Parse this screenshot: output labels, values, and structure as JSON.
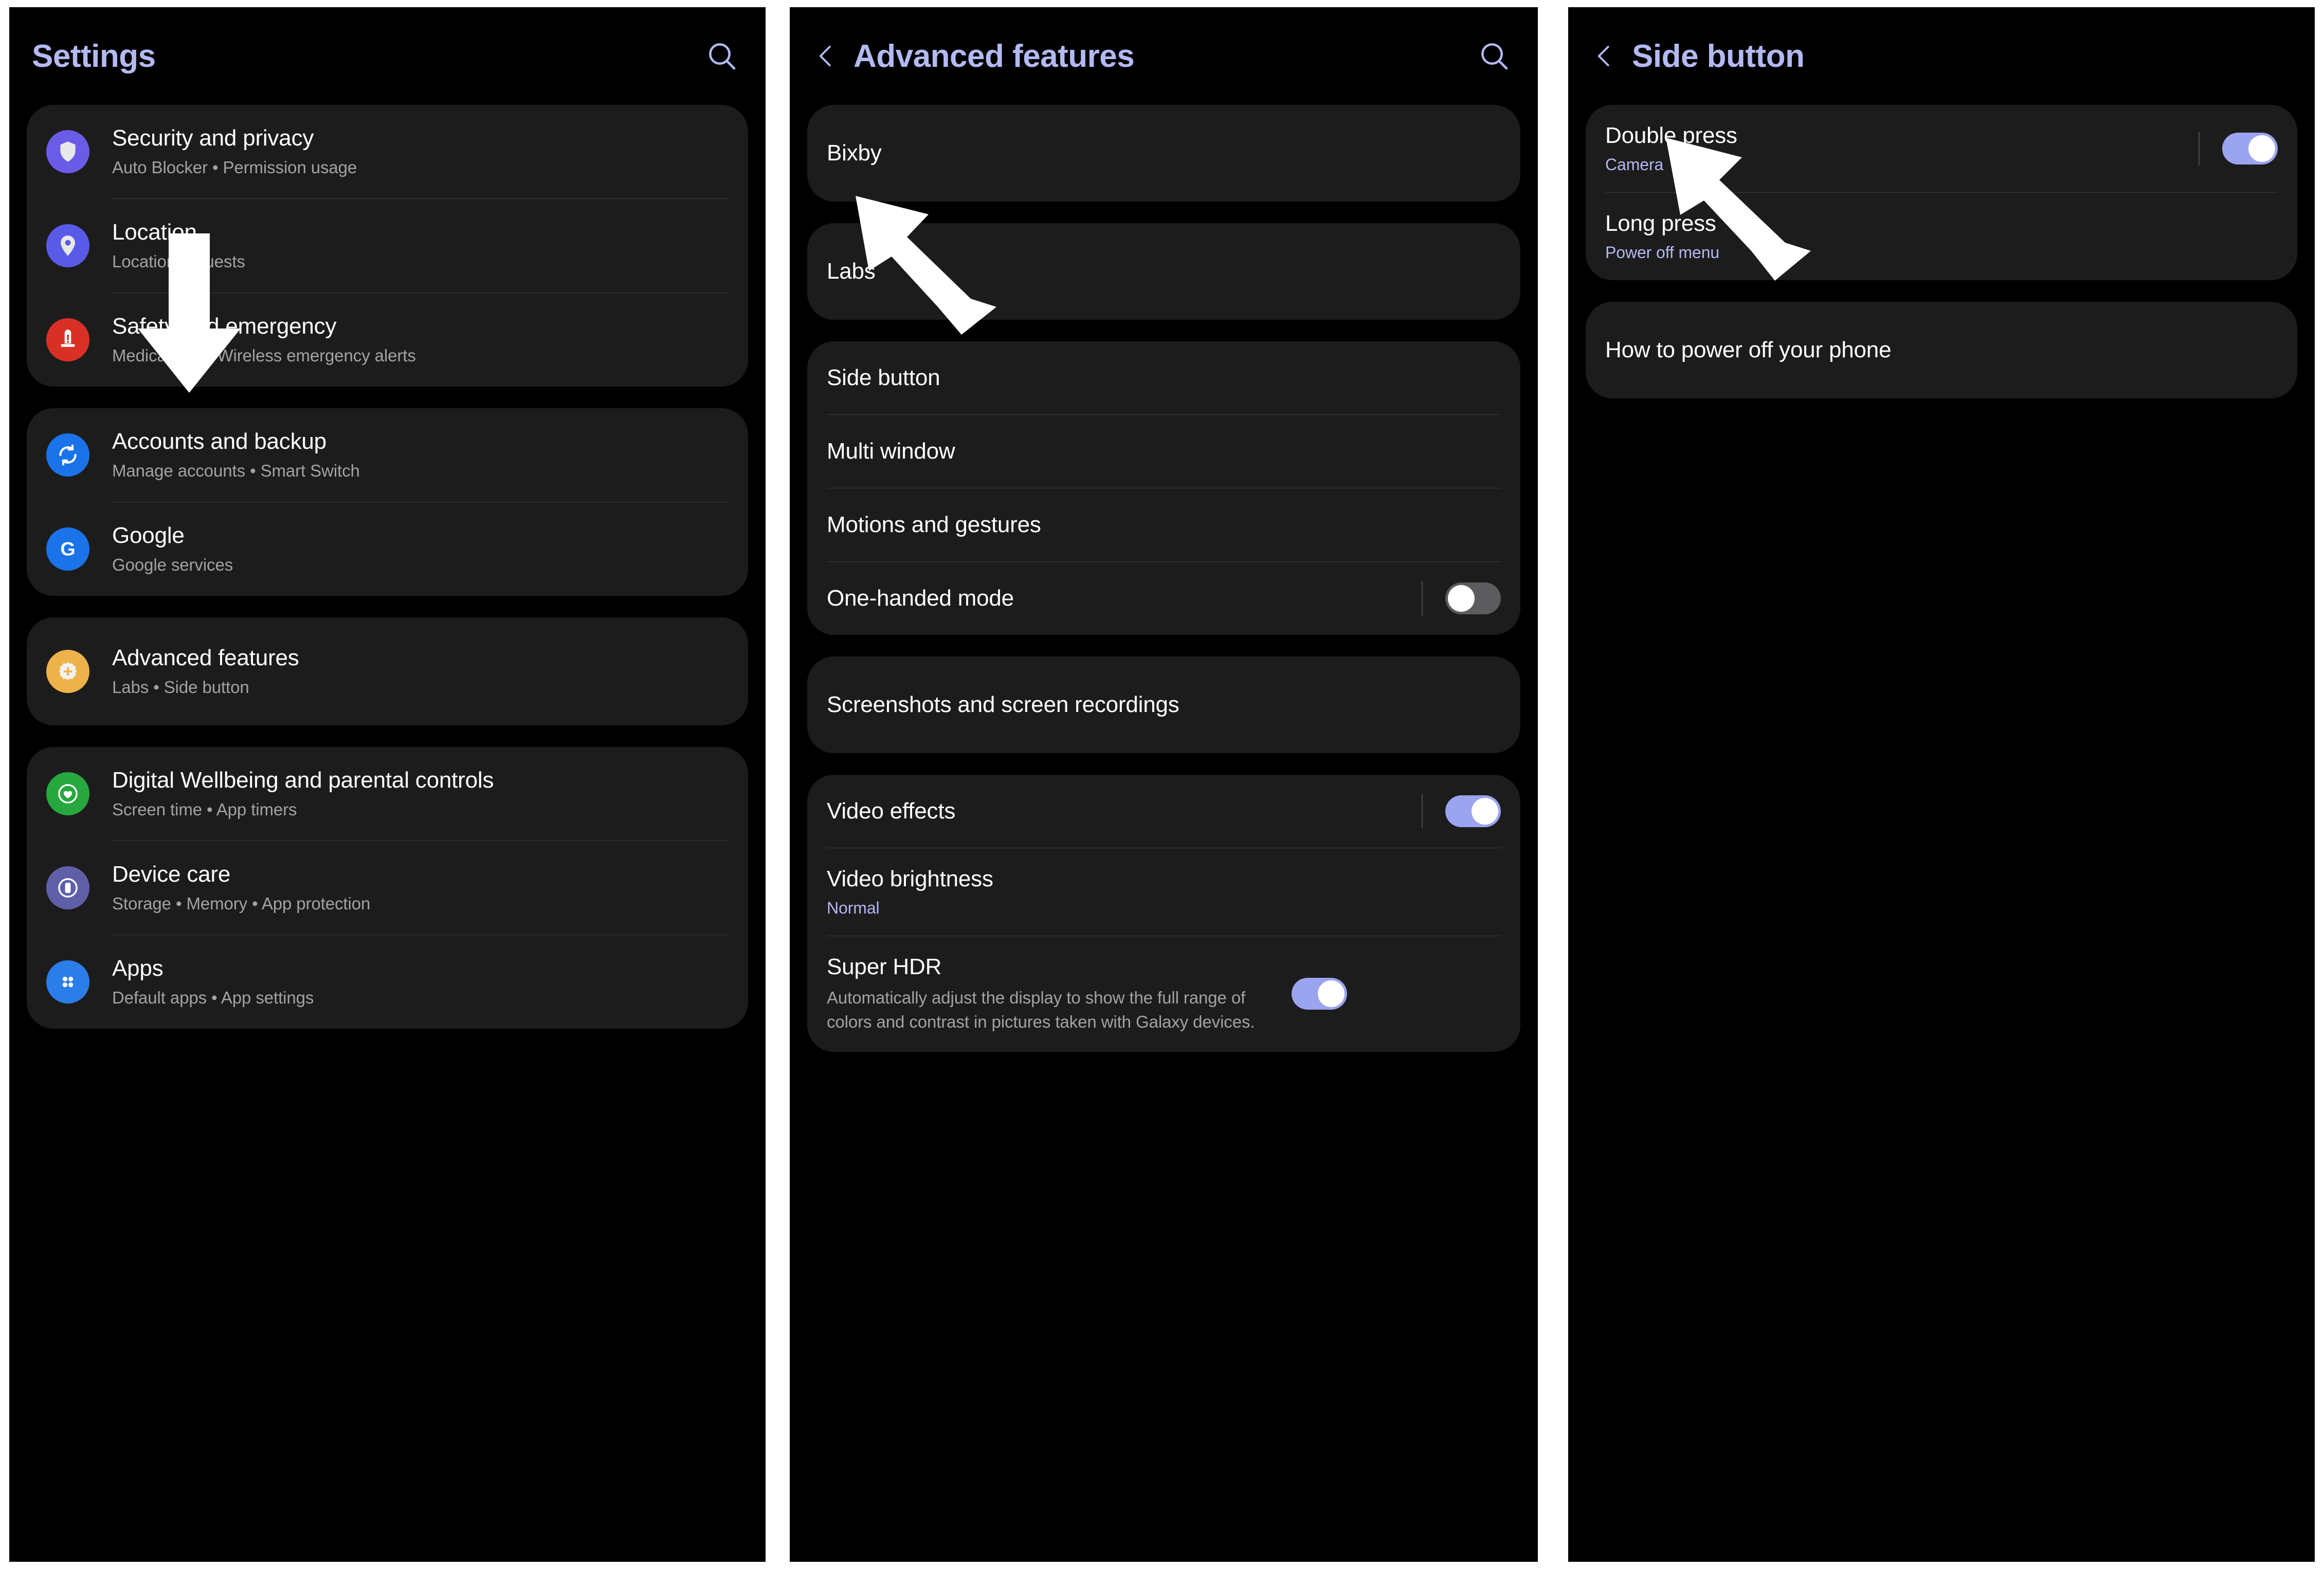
{
  "colors": {
    "panel_bg": "#000000",
    "card_bg": "#1c1c1c",
    "accent": "#b3b9f2",
    "toggle_on": "#9aa4ef",
    "toggle_off": "#5c5c5e",
    "title_text": "#ffffff",
    "sub_text": "#a3a3a3",
    "divider": "#3a3a3a"
  },
  "panels": [
    {
      "id": "settings",
      "header": {
        "title": "Settings",
        "has_back": false,
        "search_icon": "search-icon"
      },
      "groups": [
        {
          "items": [
            {
              "title": "Security and privacy",
              "sub": "Auto Blocker  •  Permission usage",
              "icon": "shield-icon",
              "icon_color": "#6b5ce7"
            },
            {
              "title": "Location",
              "sub": "Location requests",
              "icon": "location-pin-icon",
              "icon_color": "#5a5ae8"
            },
            {
              "title": "Safety and emergency",
              "sub": "Medical info  •  Wireless emergency alerts",
              "icon": "emergency-alert-icon",
              "icon_color": "#d93025"
            }
          ]
        },
        {
          "items": [
            {
              "title": "Accounts and backup",
              "sub": "Manage accounts  •  Smart Switch",
              "icon": "sync-icon",
              "icon_color": "#1a73e8"
            },
            {
              "title": "Google",
              "sub": "Google services",
              "icon": "google-g-icon",
              "icon_color": "#1a73e8"
            }
          ]
        },
        {
          "items": [
            {
              "title": "Advanced features",
              "sub": "Labs  •  Side button",
              "icon": "gear-plus-icon",
              "icon_color": "#edb24a"
            }
          ]
        },
        {
          "items": [
            {
              "title": "Digital Wellbeing and parental controls",
              "sub": "Screen time  •  App timers",
              "icon": "wellbeing-heart-icon",
              "icon_color": "#27a83f"
            },
            {
              "title": "Device care",
              "sub": "Storage  •  Memory  •  App protection",
              "icon": "device-care-icon",
              "icon_color": "#5f5fa8"
            },
            {
              "title": "Apps",
              "sub": "Default apps  •  App settings",
              "icon": "apps-grid-icon",
              "icon_color": "#2b7de9"
            }
          ]
        }
      ]
    },
    {
      "id": "advanced-features",
      "header": {
        "title": "Advanced features",
        "has_back": true,
        "search_icon": "search-icon"
      },
      "groups": [
        {
          "items": [
            {
              "title": "Bixby"
            }
          ]
        },
        {
          "items": [
            {
              "title": "Labs"
            }
          ]
        },
        {
          "items": [
            {
              "title": "Side button"
            },
            {
              "title": "Multi window"
            },
            {
              "title": "Motions and gestures"
            },
            {
              "title": "One-handed mode",
              "toggle": "off"
            }
          ]
        },
        {
          "items": [
            {
              "title": "Screenshots and screen recordings"
            }
          ]
        },
        {
          "items": [
            {
              "title": "Video effects",
              "toggle": "on"
            },
            {
              "title": "Video brightness",
              "sub": "Normal",
              "sub_accent": true
            },
            {
              "title": "Super HDR",
              "sub": "Automatically adjust the display to show the full range of colors and contrast in pictures taken with Galaxy devices.",
              "toggle": "on"
            }
          ]
        }
      ]
    },
    {
      "id": "side-button",
      "header": {
        "title": "Side button",
        "has_back": true,
        "search_icon": null
      },
      "groups": [
        {
          "items": [
            {
              "title": "Double press",
              "sub": "Camera",
              "sub_accent": true,
              "toggle": "on"
            },
            {
              "title": "Long press",
              "sub": "Power off menu",
              "sub_accent": true
            }
          ]
        },
        {
          "items": [
            {
              "title": "How to power off your phone"
            }
          ]
        }
      ]
    }
  ],
  "annotations": [
    {
      "name": "down-arrow-to-advanced-features",
      "panel": 1,
      "direction": "down"
    },
    {
      "name": "up-left-arrow-to-side-button",
      "panel": 2,
      "direction": "up-left"
    },
    {
      "name": "up-left-arrow-to-long-press",
      "panel": 3,
      "direction": "up-left"
    }
  ]
}
